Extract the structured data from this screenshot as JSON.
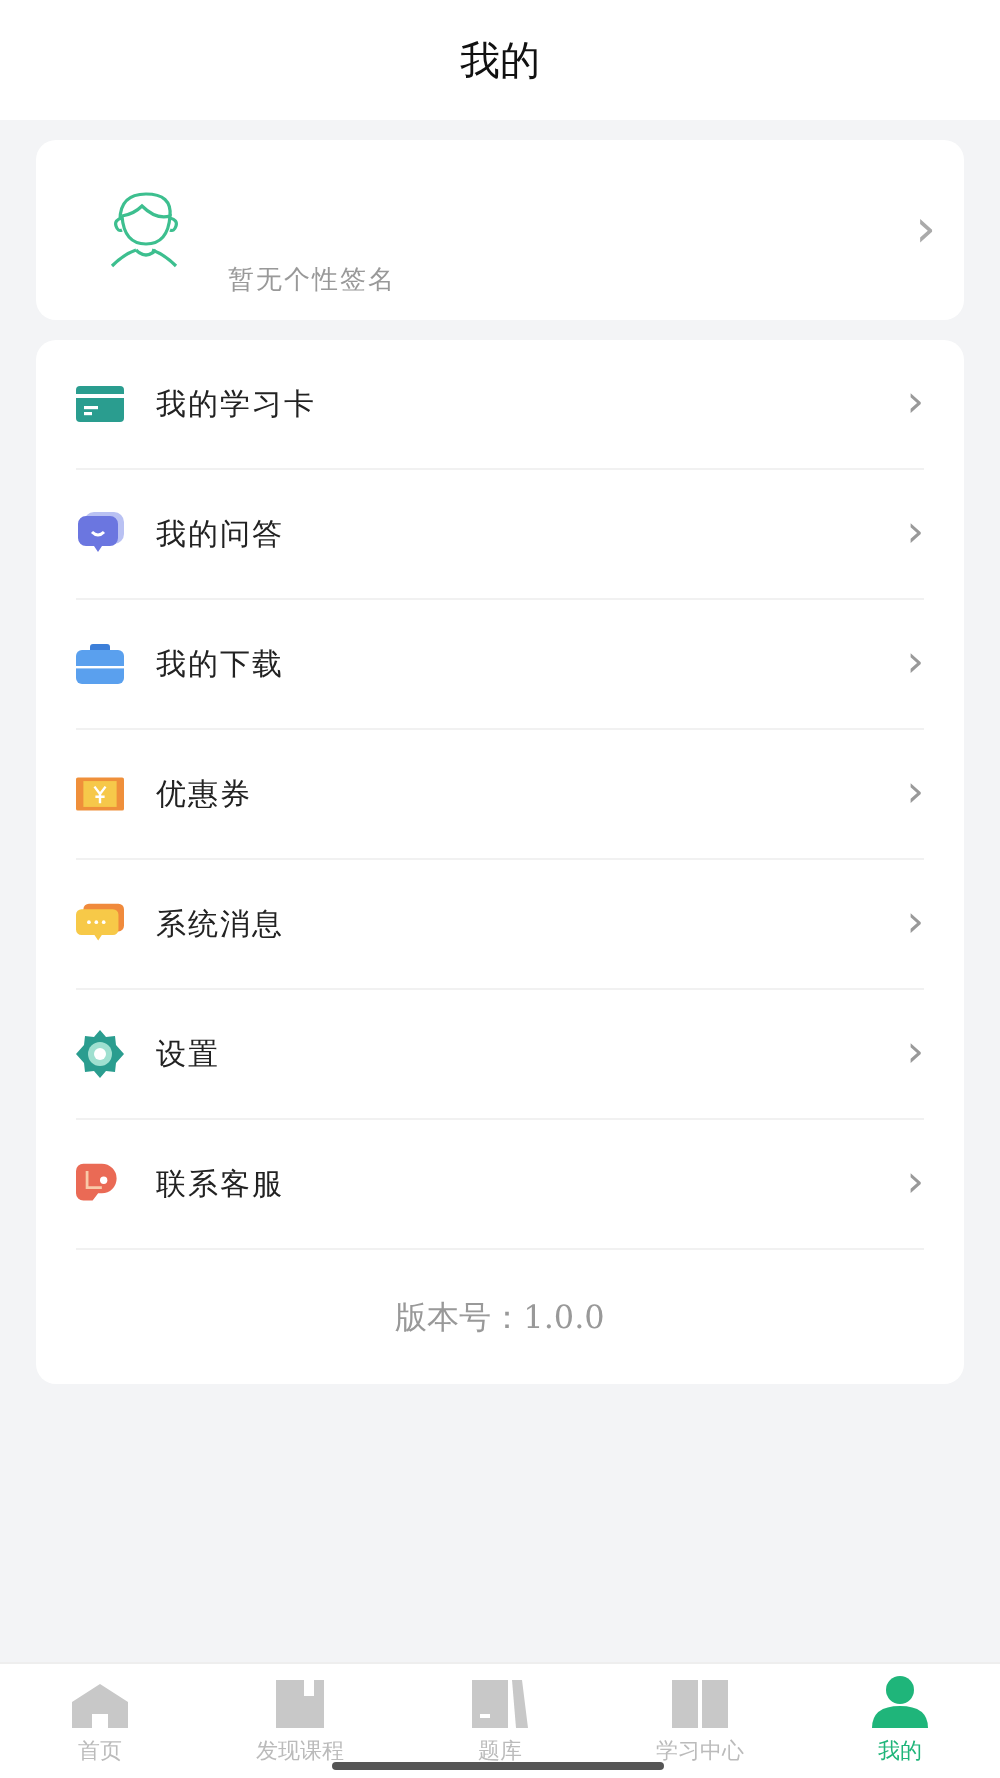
{
  "header": {
    "title": "我的"
  },
  "profile": {
    "signature": "暂无个性签名",
    "chevron": "›"
  },
  "menu": [
    {
      "label": "我的学习卡",
      "chevron": "›"
    },
    {
      "label": "我的问答",
      "chevron": "›"
    },
    {
      "label": "我的下载",
      "chevron": "›"
    },
    {
      "label": "优惠券",
      "chevron": "›"
    },
    {
      "label": "系统消息",
      "chevron": "›"
    },
    {
      "label": "设置",
      "chevron": "›"
    },
    {
      "label": "联系客服",
      "chevron": "›"
    }
  ],
  "version": "版本号：1.0.0",
  "tabs": [
    {
      "label": "首页",
      "selected": false
    },
    {
      "label": "发现课程",
      "selected": false
    },
    {
      "label": "题库",
      "selected": false
    },
    {
      "label": "学习中心",
      "selected": false
    },
    {
      "label": "我的",
      "selected": true
    }
  ]
}
